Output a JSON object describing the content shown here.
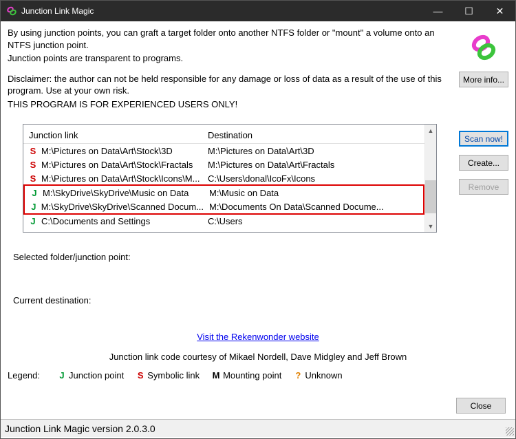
{
  "window": {
    "title": "Junction Link Magic",
    "minimize": "—",
    "maximize": "☐",
    "close": "✕"
  },
  "intro": {
    "p1": "By using junction points, you can graft a target folder onto another NTFS folder or \"mount\" a volume onto an NTFS junction point.",
    "p2": "Junction points are transparent to programs.",
    "p3": "Disclaimer: the author can not be held responsible for any damage or loss of data as a result of the use of this program. Use at your own risk.",
    "p4": "THIS PROGRAM IS FOR EXPERIENCED USERS ONLY!"
  },
  "buttons": {
    "more_info": "More info...",
    "scan_now": "Scan now!",
    "create": "Create...",
    "remove": "Remove",
    "close": "Close"
  },
  "list": {
    "header_link": "Junction link",
    "header_dest": "Destination",
    "rows": [
      {
        "type": "S",
        "link": "M:\\Pictures on Data\\Art\\Stock\\3D",
        "dest": "M:\\Pictures on Data\\Art\\3D"
      },
      {
        "type": "S",
        "link": "M:\\Pictures on Data\\Art\\Stock\\Fractals",
        "dest": "M:\\Pictures on Data\\Art\\Fractals"
      },
      {
        "type": "S",
        "link": "M:\\Pictures on Data\\Art\\Stock\\Icons\\M...",
        "dest": "C:\\Users\\donal\\IcoFx\\Icons"
      },
      {
        "type": "J",
        "link": "M:\\SkyDrive\\SkyDrive\\Music on Data",
        "dest": "M:\\Music on Data"
      },
      {
        "type": "J",
        "link": "M:\\SkyDrive\\SkyDrive\\Scanned Docum...",
        "dest": "M:\\Documents On Data\\Scanned Docume..."
      },
      {
        "type": "J",
        "link": "C:\\Documents and Settings",
        "dest": "C:\\Users"
      }
    ]
  },
  "labels": {
    "selected": "Selected folder/junction point:",
    "current_dest": "Current destination:",
    "website": "Visit the Rekenwonder website",
    "courtesy": "Junction link code courtesy of Mikael Nordell, Dave Midgley and Jeff Brown",
    "legend": "Legend:"
  },
  "legend": {
    "J": "Junction point",
    "S": "Symbolic link",
    "M": "Mounting point",
    "Q": "Unknown"
  },
  "status": "Junction Link Magic version 2.0.3.0"
}
